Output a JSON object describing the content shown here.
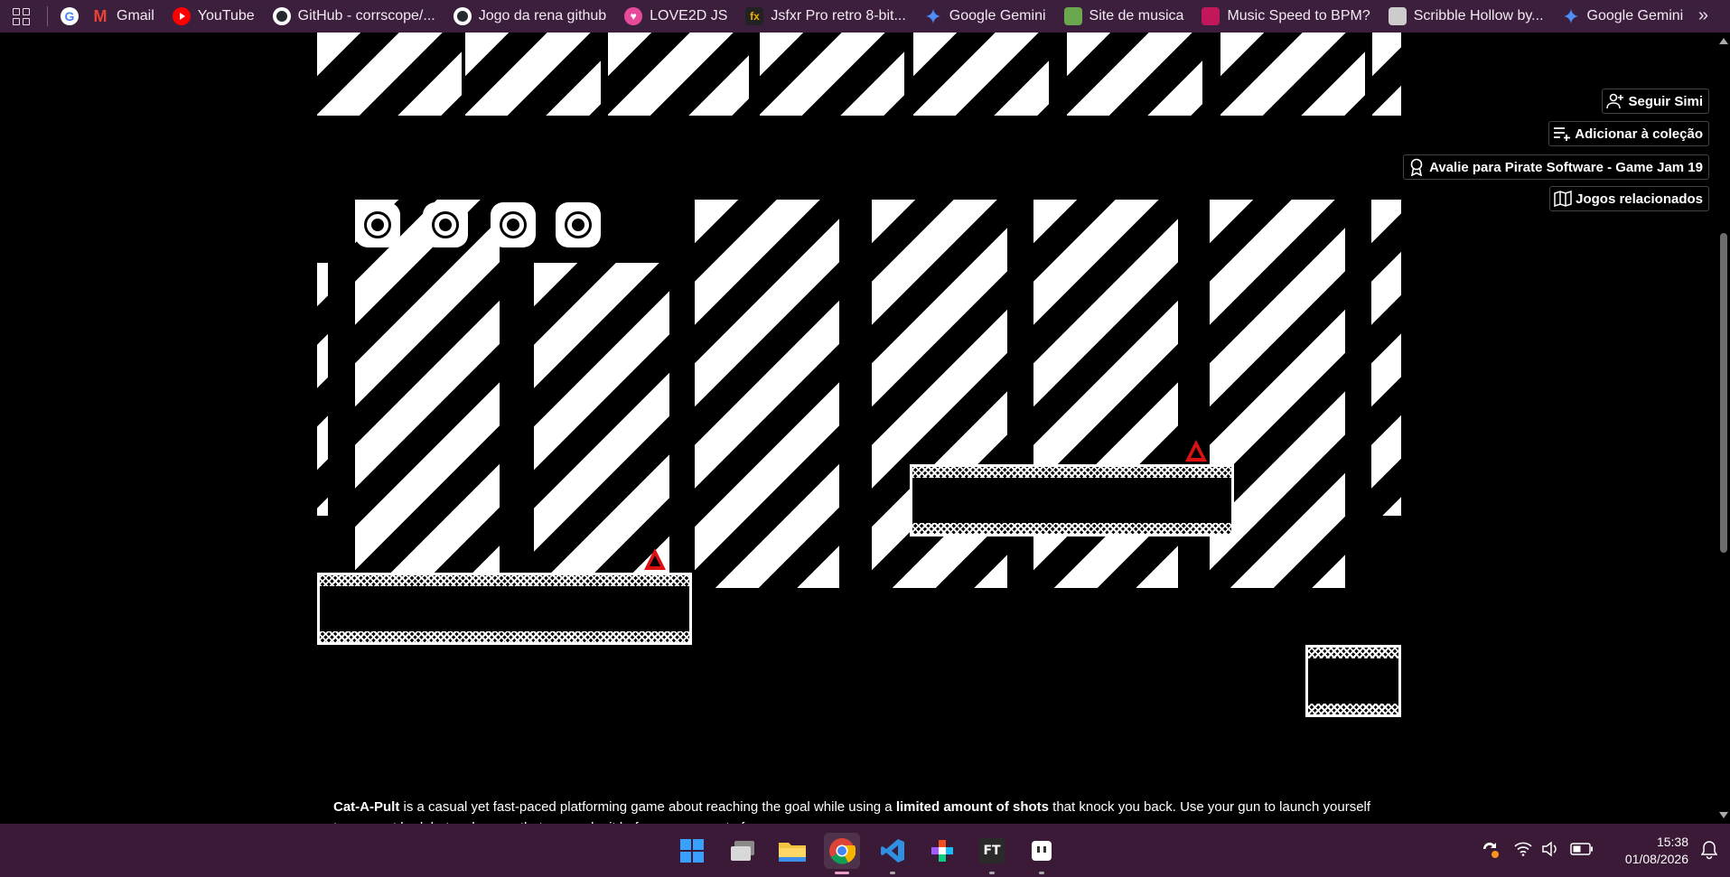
{
  "bookmarks": {
    "items": [
      {
        "label": "",
        "icon": "google-icon",
        "color": "#ffffff"
      },
      {
        "label": "Gmail",
        "icon": "gmail-icon",
        "color": "#ea4335"
      },
      {
        "label": "YouTube",
        "icon": "youtube-icon",
        "color": "#ff0000"
      },
      {
        "label": "GitHub - corrscope/...",
        "icon": "github-icon",
        "color": "#ffffff"
      },
      {
        "label": "Jogo da rena github",
        "icon": "github-icon",
        "color": "#ffffff"
      },
      {
        "label": "LOVE2D JS",
        "icon": "love2d-icon",
        "color": "#e74a99"
      },
      {
        "label": "Jsfxr Pro retro 8-bit...",
        "icon": "jsfxr-icon",
        "color": "#f0b000"
      },
      {
        "label": "Google Gemini",
        "icon": "gemini-icon",
        "color": "#4f8ef7"
      },
      {
        "label": "Site de musica",
        "icon": "music-site-icon",
        "color": "#6aa84f"
      },
      {
        "label": "Music Speed to BPM?",
        "icon": "bpm-icon",
        "color": "#c2185b"
      },
      {
        "label": "Scribble Hollow by...",
        "icon": "scribble-hollow-icon",
        "color": "#cccccc"
      },
      {
        "label": "Google Gemini",
        "icon": "gemini-icon",
        "color": "#4f8ef7"
      }
    ],
    "more_icon": "chevron-double-right-icon"
  },
  "actions": {
    "follow": {
      "label": "Seguir Simi",
      "icon": "user-plus-icon"
    },
    "collection": {
      "label": "Adicionar à coleção",
      "icon": "playlist-add-icon"
    },
    "rate": {
      "label": "Avalie para Pirate Software - Game Jam 19",
      "icon": "award-icon"
    },
    "related": {
      "label": "Jogos relacionados",
      "icon": "map-icon"
    }
  },
  "description": {
    "title": "Cat-A-Pult",
    "text_1": " is a casual yet fast-paced platforming game about reaching the goal while using a ",
    "bold_2": "limited amount of shots",
    "text_3": " that knock you back. Use your gun to launch yourself to your cat bed, but make sure that you make it before you run out of ammo."
  },
  "taskbar": {
    "apps": [
      "windows-start-icon",
      "task-view-icon",
      "file-explorer-icon",
      "chrome-icon",
      "vscode-icon",
      "figma-icon",
      "ft-app-icon",
      "tldraw-icon"
    ],
    "active": "chrome-icon",
    "clock": {
      "time": "15:38",
      "date": "01/08/2026"
    },
    "tray": [
      "sync-icon",
      "wifi-icon",
      "volume-icon",
      "battery-icon",
      "notification-icon"
    ]
  }
}
